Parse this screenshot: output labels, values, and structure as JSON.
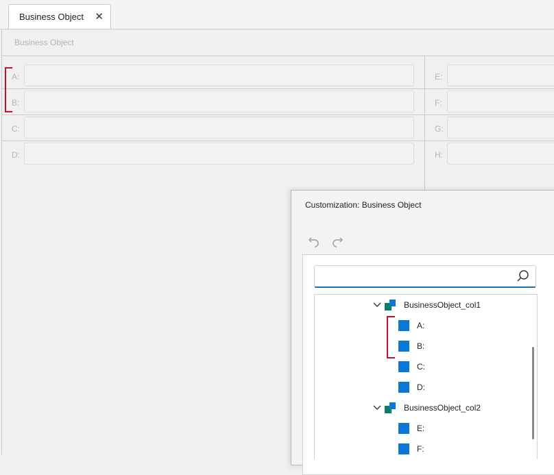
{
  "tab": {
    "label": "Business Object"
  },
  "group": {
    "title": "Business Object"
  },
  "fields": {
    "left": [
      "A:",
      "B:",
      "C:",
      "D:"
    ],
    "right": [
      "E:",
      "F:",
      "G:",
      "H:"
    ]
  },
  "dialog": {
    "title": "Customization: Business Object",
    "search": {
      "value": "",
      "placeholder": ""
    },
    "tree": {
      "group1": "BusinessObject_col1",
      "group1_items": [
        "A:",
        "B:",
        "C:",
        "D:"
      ],
      "group2": "BusinessObject_col2",
      "group2_items": [
        "E:",
        "F:"
      ]
    }
  },
  "icons": {
    "tab_close": "close-icon",
    "undo": "undo-icon",
    "redo": "redo-icon",
    "search": "search-icon",
    "expand": "chevron-down-icon",
    "group": "layout-group-icon",
    "item": "layout-item-icon"
  },
  "colors": {
    "accent": "#0a78d4",
    "group_icon_dark": "#0e7d6b",
    "highlight": "#c8102e"
  }
}
